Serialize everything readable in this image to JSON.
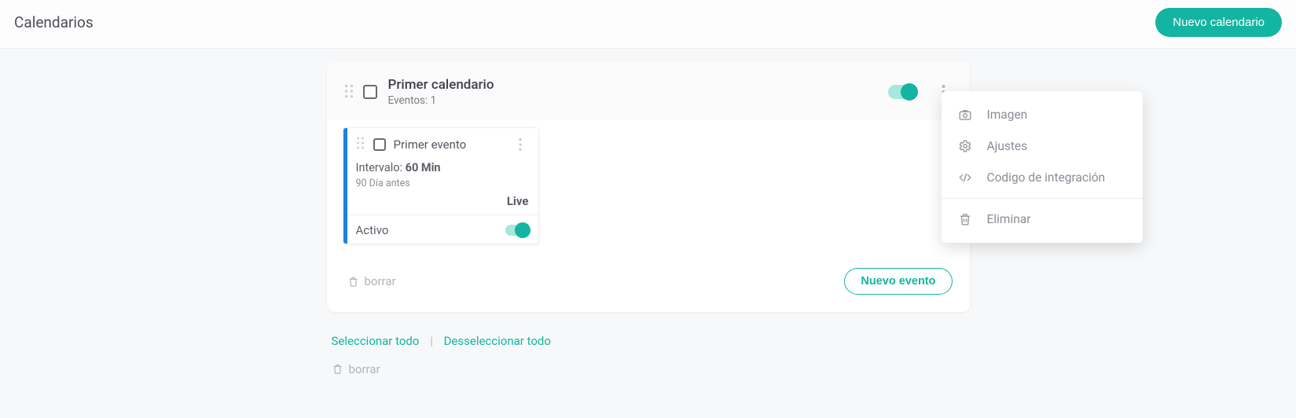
{
  "header": {
    "title": "Calendarios",
    "new_button": "Nuevo calendario"
  },
  "calendar": {
    "name": "Primer calendario",
    "events_label": "Eventos:",
    "events_count": "1",
    "delete_label": "borrar",
    "new_event_label": "Nuevo evento"
  },
  "event": {
    "name": "Primer evento",
    "interval_label": "Intervalo:",
    "interval_value": "60 Min",
    "before_text": "90 Día antes",
    "live_label": "Live",
    "active_label": "Activo"
  },
  "menu": {
    "imagen": "Imagen",
    "ajustes": "Ajustes",
    "codigo": "Codigo de integración",
    "eliminar": "Eliminar"
  },
  "footer": {
    "select_all": "Seleccionar todo",
    "deselect_all": "Desseleccionar todo",
    "separator": "|",
    "delete": "borrar"
  }
}
